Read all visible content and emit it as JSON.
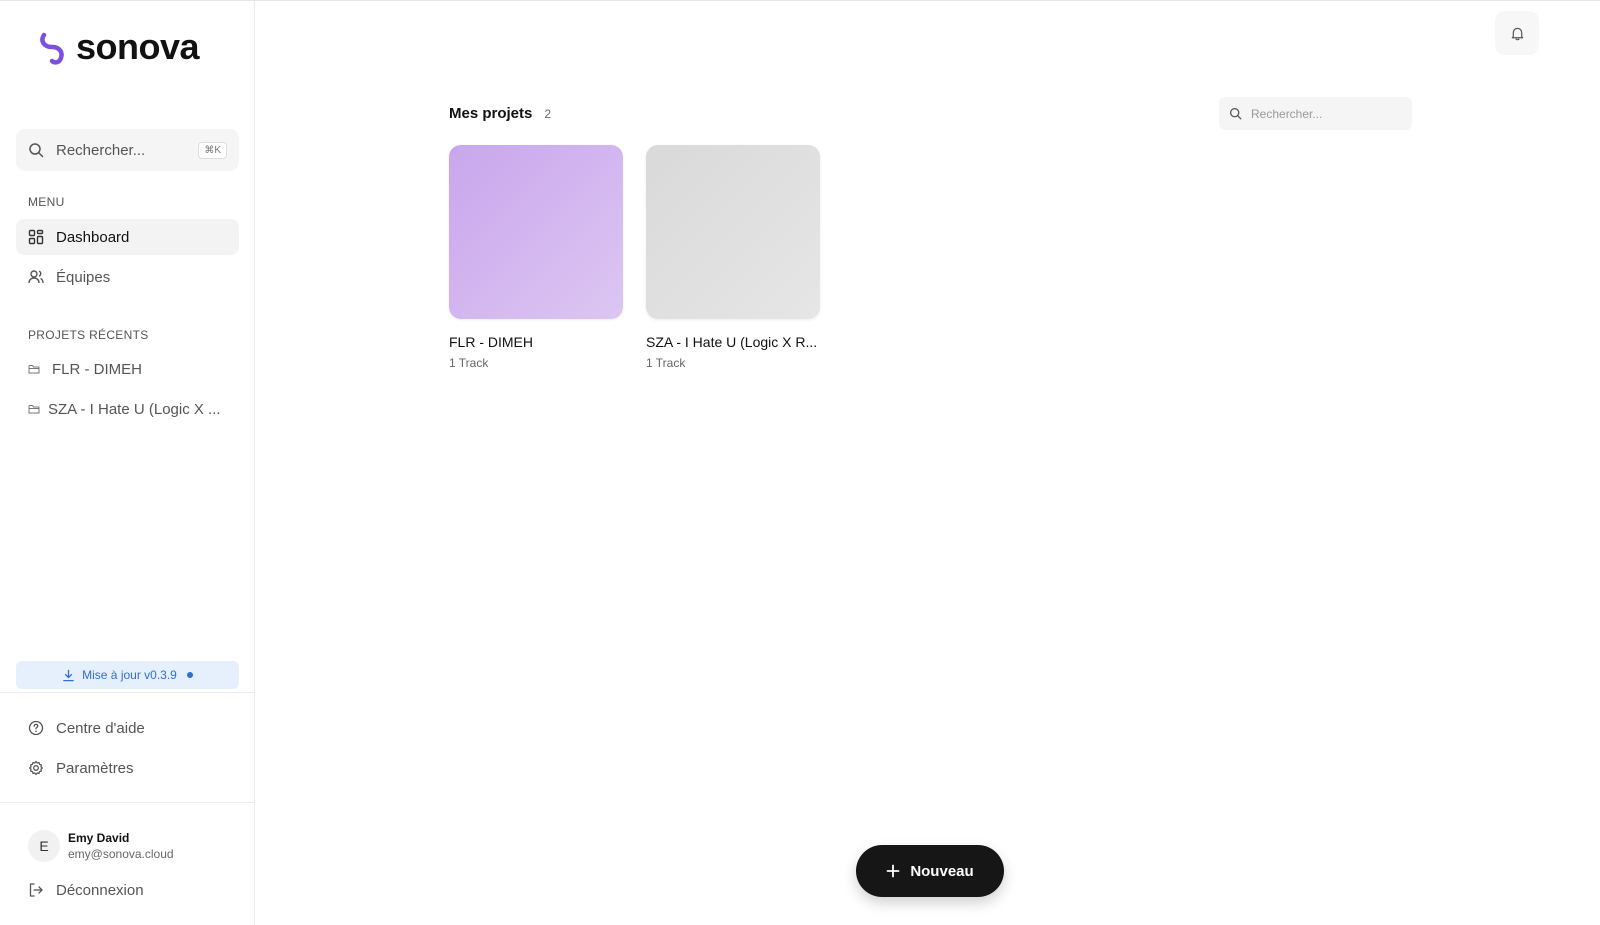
{
  "app": {
    "logo_text": "sonova",
    "brand_color": "#7b4fe0"
  },
  "sidebar": {
    "search": {
      "placeholder": "Rechercher...",
      "shortcut": "⌘K"
    },
    "menu_label": "MENU",
    "menu_items": [
      {
        "label": "Dashboard",
        "icon": "grid-icon",
        "active": true
      },
      {
        "label": "Équipes",
        "icon": "users-icon",
        "active": false
      }
    ],
    "recent_label": "PROJETS RÉCENTS",
    "recent_items": [
      {
        "label": "FLR - DIMEH",
        "icon": "folder-icon"
      },
      {
        "label": "SZA - I Hate U (Logic X ...",
        "icon": "folder-icon"
      }
    ],
    "update_label": "Mise à jour v0.3.9",
    "footer_items": [
      {
        "label": "Centre d'aide",
        "icon": "help-circle-icon"
      },
      {
        "label": "Paramètres",
        "icon": "gear-icon"
      }
    ],
    "user": {
      "initial": "E",
      "name": "Emy David",
      "email": "emy@sonova.cloud"
    },
    "logout_label": "Déconnexion"
  },
  "main": {
    "title": "Mes projets",
    "count": "2",
    "search_placeholder": "Rechercher...",
    "projects": [
      {
        "name": "FLR - DIMEH",
        "tracks": "1 Track",
        "color": "#d4b4f0"
      },
      {
        "name": "SZA - I Hate U (Logic X R...",
        "tracks": "1 Track",
        "color": "#e0e0e0"
      }
    ],
    "new_button": "Nouveau"
  }
}
